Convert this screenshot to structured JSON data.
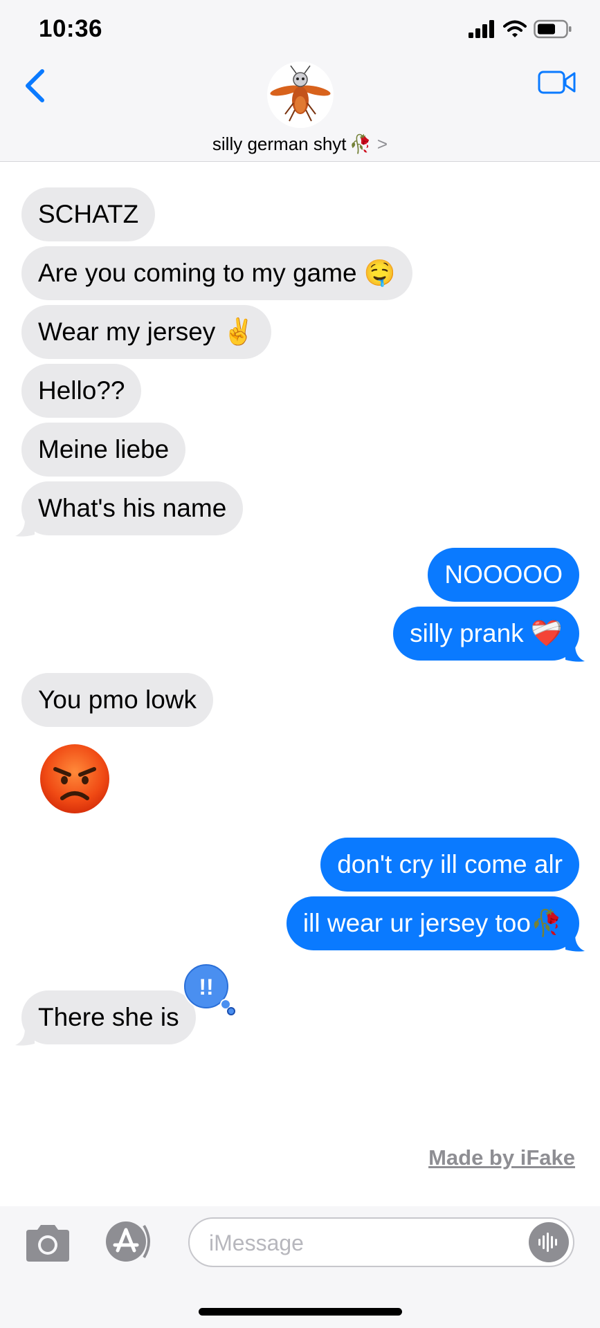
{
  "status_bar": {
    "time": "10:36"
  },
  "header": {
    "contact_name": "silly german shyt",
    "contact_name_emoji": "🥀",
    "chevron": ">"
  },
  "messages": [
    {
      "direction": "incoming",
      "text": "SCHATZ"
    },
    {
      "direction": "incoming",
      "text": "Are you coming to my game 🤤"
    },
    {
      "direction": "incoming",
      "text": "Wear my jersey ✌️"
    },
    {
      "direction": "incoming",
      "text": "Hello??"
    },
    {
      "direction": "incoming",
      "text": "Meine liebe"
    },
    {
      "direction": "incoming",
      "text": "What's his name"
    },
    {
      "direction": "outgoing",
      "text": "NOOOOO"
    },
    {
      "direction": "outgoing",
      "text": "silly prank ❤️‍🩹"
    },
    {
      "direction": "incoming",
      "text": "You pmo lowk"
    },
    {
      "direction": "incoming",
      "text": "😡",
      "emoji_only": true
    },
    {
      "direction": "outgoing",
      "text": "don't cry ill come alr"
    },
    {
      "direction": "outgoing",
      "text": "ill wear ur jersey too🥀"
    },
    {
      "direction": "incoming",
      "text": "There she is",
      "reaction": "!!"
    }
  ],
  "watermark": "Made by iFake",
  "composer": {
    "placeholder": "iMessage"
  },
  "colors": {
    "accent": "#0a7aff",
    "incoming_bubble": "#e9e9eb",
    "outgoing_bubble": "#0a7aff",
    "header_bg": "#f6f6f8"
  }
}
